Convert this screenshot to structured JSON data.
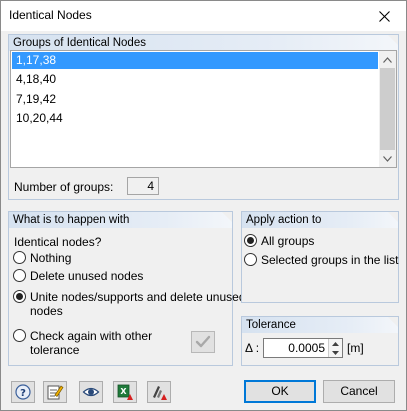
{
  "window": {
    "title": "Identical Nodes"
  },
  "groups": {
    "header": "Groups of Identical Nodes",
    "items": [
      "1,17,38",
      "4,18,40",
      "7,19,42",
      "10,20,44"
    ],
    "selected_index": 0,
    "count_label": "Number of groups:",
    "count_value": "4"
  },
  "action": {
    "header": "What is to happen with",
    "question": "Identical nodes?",
    "options": [
      {
        "label": "Nothing",
        "checked": false
      },
      {
        "label": "Delete unused nodes",
        "checked": false
      },
      {
        "label_line1": "Unite nodes/supports and delete unused",
        "label_line2": "nodes",
        "checked": true
      },
      {
        "label_line1": "Check again with other",
        "label_line2": "tolerance",
        "checked": false
      }
    ]
  },
  "apply": {
    "header": "Apply action to",
    "options": [
      {
        "label": "All groups",
        "checked": true
      },
      {
        "label": "Selected groups in the list",
        "checked": false
      }
    ]
  },
  "tolerance": {
    "header": "Tolerance",
    "symbol": "Δ :",
    "value": "0.0005",
    "unit": "[m]"
  },
  "buttons": {
    "ok": "OK",
    "cancel": "Cancel"
  },
  "icons": [
    "help-icon",
    "edit-icon",
    "view-icon",
    "export-excel-icon",
    "delete-nodes-icon"
  ]
}
